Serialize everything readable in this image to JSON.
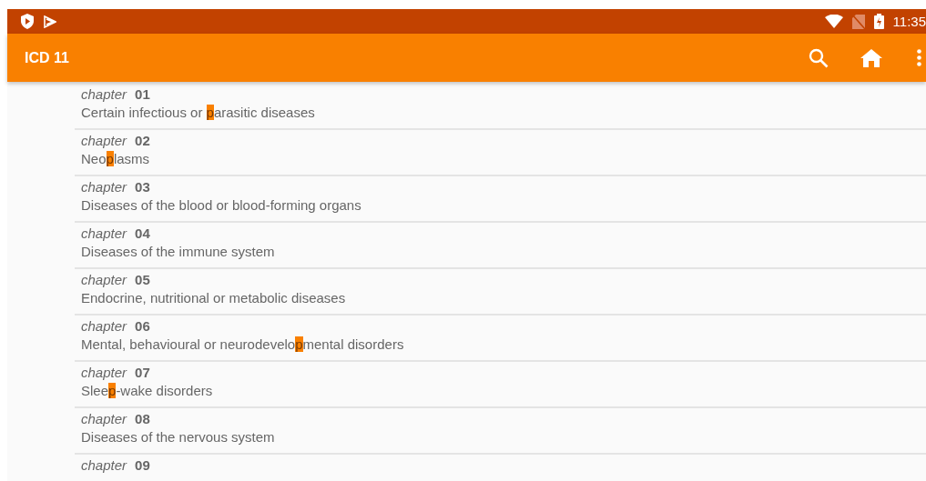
{
  "status_bar": {
    "time": "11:35"
  },
  "app_bar": {
    "title": "ICD 11"
  },
  "chapters": [
    {
      "label": "chapter",
      "number": "01",
      "segments": [
        {
          "text": "Certain infectious or ",
          "highlighted": false
        },
        {
          "text": "p",
          "highlighted": true
        },
        {
          "text": "arasitic diseases",
          "highlighted": false
        }
      ]
    },
    {
      "label": "chapter",
      "number": "02",
      "segments": [
        {
          "text": "Neo",
          "highlighted": false
        },
        {
          "text": "p",
          "highlighted": true
        },
        {
          "text": "lasms",
          "highlighted": false
        }
      ]
    },
    {
      "label": "chapter",
      "number": "03",
      "segments": [
        {
          "text": "Diseases of the blood or blood-forming organs",
          "highlighted": false
        }
      ]
    },
    {
      "label": "chapter",
      "number": "04",
      "segments": [
        {
          "text": "Diseases of the immune system",
          "highlighted": false
        }
      ]
    },
    {
      "label": "chapter",
      "number": "05",
      "segments": [
        {
          "text": "Endocrine, nutritional or metabolic diseases",
          "highlighted": false
        }
      ]
    },
    {
      "label": "chapter",
      "number": "06",
      "segments": [
        {
          "text": "Mental, behavioural or neurodevelo",
          "highlighted": false
        },
        {
          "text": "p",
          "highlighted": true
        },
        {
          "text": "mental disorders",
          "highlighted": false
        }
      ]
    },
    {
      "label": "chapter",
      "number": "07",
      "segments": [
        {
          "text": "Slee",
          "highlighted": false
        },
        {
          "text": "p",
          "highlighted": true
        },
        {
          "text": "-wake disorders",
          "highlighted": false
        }
      ]
    },
    {
      "label": "chapter",
      "number": "08",
      "segments": [
        {
          "text": "Diseases of the nervous system",
          "highlighted": false
        }
      ]
    },
    {
      "label": "chapter",
      "number": "09"
    }
  ]
}
